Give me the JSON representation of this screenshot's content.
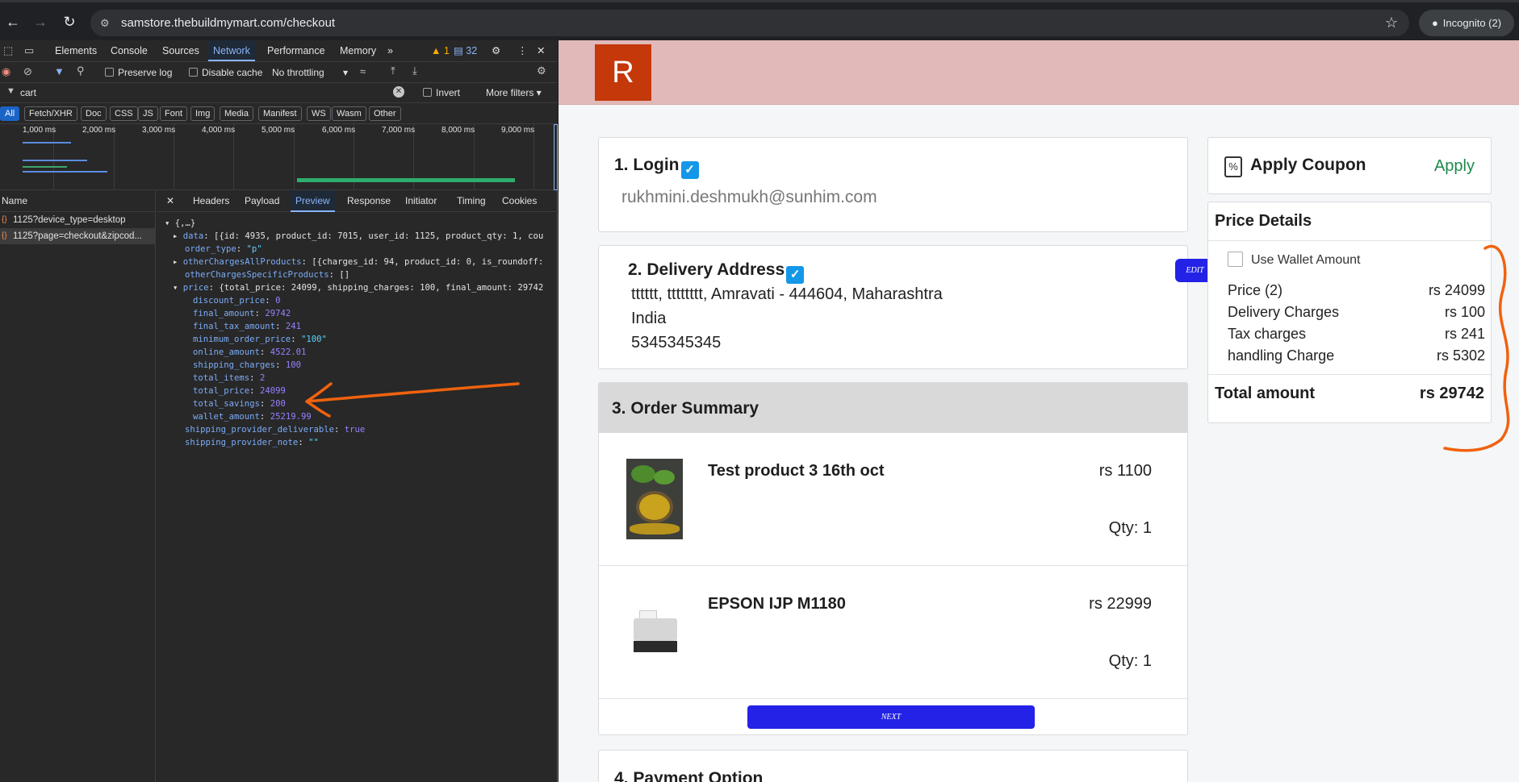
{
  "browser": {
    "url": "samstore.thebuildmymart.com/checkout",
    "incognito_label": "Incognito (2)"
  },
  "devtools": {
    "tabs": [
      "Elements",
      "Console",
      "Sources",
      "Network",
      "Performance",
      "Memory"
    ],
    "active_tab": "Network",
    "warnings": "1",
    "messages": "32",
    "preserve_log": "Preserve log",
    "disable_cache": "Disable cache",
    "throttling": "No throttling",
    "filter_value": "cart",
    "invert": "Invert",
    "more_filters": "More filters",
    "type_filters": [
      "All",
      "Fetch/XHR",
      "Doc",
      "CSS",
      "JS",
      "Font",
      "Img",
      "Media",
      "Manifest",
      "WS",
      "Wasm",
      "Other"
    ],
    "timeline_ticks": [
      "1,000 ms",
      "2,000 ms",
      "3,000 ms",
      "4,000 ms",
      "5,000 ms",
      "6,000 ms",
      "7,000 ms",
      "8,000 ms",
      "9,000 ms"
    ],
    "name_header": "Name",
    "requests": [
      "1125?device_type=desktop",
      "1125?page=checkout&zipcod..."
    ],
    "preview_tabs": [
      "Headers",
      "Payload",
      "Preview",
      "Response",
      "Initiator",
      "Timing",
      "Cookies"
    ],
    "active_preview_tab": "Preview",
    "json_lines": {
      "root": "{,…}",
      "data_key": "data",
      "data_val": "[{id: 4935, product_id: 7015, user_id: 1125, product_qty: 1, cou",
      "order_type_key": "order_type",
      "order_type_val": "\"p\"",
      "other_all_key": "otherChargesAllProducts",
      "other_all_val": "[{charges_id: 94, product_id: 0, is_roundoff:",
      "other_spec_key": "otherChargesSpecificProducts",
      "other_spec_val": "[]",
      "price_key": "price",
      "price_val": "{total_price: 24099, shipping_charges: 100, final_amount: 29742",
      "price_fields": [
        {
          "k": "discount_price",
          "v": "0",
          "t": "n"
        },
        {
          "k": "final_amount",
          "v": "29742",
          "t": "n"
        },
        {
          "k": "final_tax_amount",
          "v": "241",
          "t": "n"
        },
        {
          "k": "minimum_order_price",
          "v": "\"100\"",
          "t": "s"
        },
        {
          "k": "online_amount",
          "v": "4522.01",
          "t": "n"
        },
        {
          "k": "shipping_charges",
          "v": "100",
          "t": "n"
        },
        {
          "k": "total_items",
          "v": "2",
          "t": "n"
        },
        {
          "k": "total_price",
          "v": "24099",
          "t": "n"
        },
        {
          "k": "total_savings",
          "v": "200",
          "t": "n"
        },
        {
          "k": "wallet_amount",
          "v": "25219.99",
          "t": "n"
        }
      ],
      "deliverable_key": "shipping_provider_deliverable",
      "deliverable_val": "true",
      "note_key": "shipping_provider_note",
      "note_val": "\"\""
    }
  },
  "site": {
    "logo_letter": "R",
    "login": {
      "title": "1. Login",
      "email": "rukhmini.deshmukh@sunhim.com"
    },
    "delivery": {
      "title": "2. Delivery Address",
      "edit_label": "EDIT",
      "line1": "tttttt, tttttttt, Amravati - 444604, Maharashtra",
      "line2": "India",
      "line3": "5345345345"
    },
    "order_summary": {
      "title": "3. Order Summary",
      "products": [
        {
          "name": "Test product 3 16th oct",
          "price": "rs 1100",
          "qty": "Qty: 1"
        },
        {
          "name": "EPSON IJP M1180",
          "price": "rs 22999",
          "qty": "Qty: 1"
        }
      ],
      "next_label": "NEXT"
    },
    "payment": {
      "title": "4. Payment Option"
    },
    "coupon": {
      "title": "Apply Coupon",
      "apply_label": "Apply"
    },
    "price_details": {
      "title": "Price Details",
      "wallet_label": "Use Wallet Amount",
      "rows": [
        {
          "label": "Price (2)",
          "value": "rs 24099"
        },
        {
          "label": "Delivery Charges",
          "value": "rs 100"
        },
        {
          "label": "Tax charges",
          "value": "rs 241"
        },
        {
          "label": "handling Charge",
          "value": "rs 5302"
        }
      ],
      "total_label": "Total amount",
      "total_value": "rs 29742"
    }
  },
  "colors": {
    "header_bg": "#e2b9b9",
    "logo_bg": "#c4380a",
    "button_blue": "#2322e6",
    "check_blue": "#1497e8",
    "apply_green": "#1d8a4a",
    "annotation_orange": "#f0620f"
  }
}
